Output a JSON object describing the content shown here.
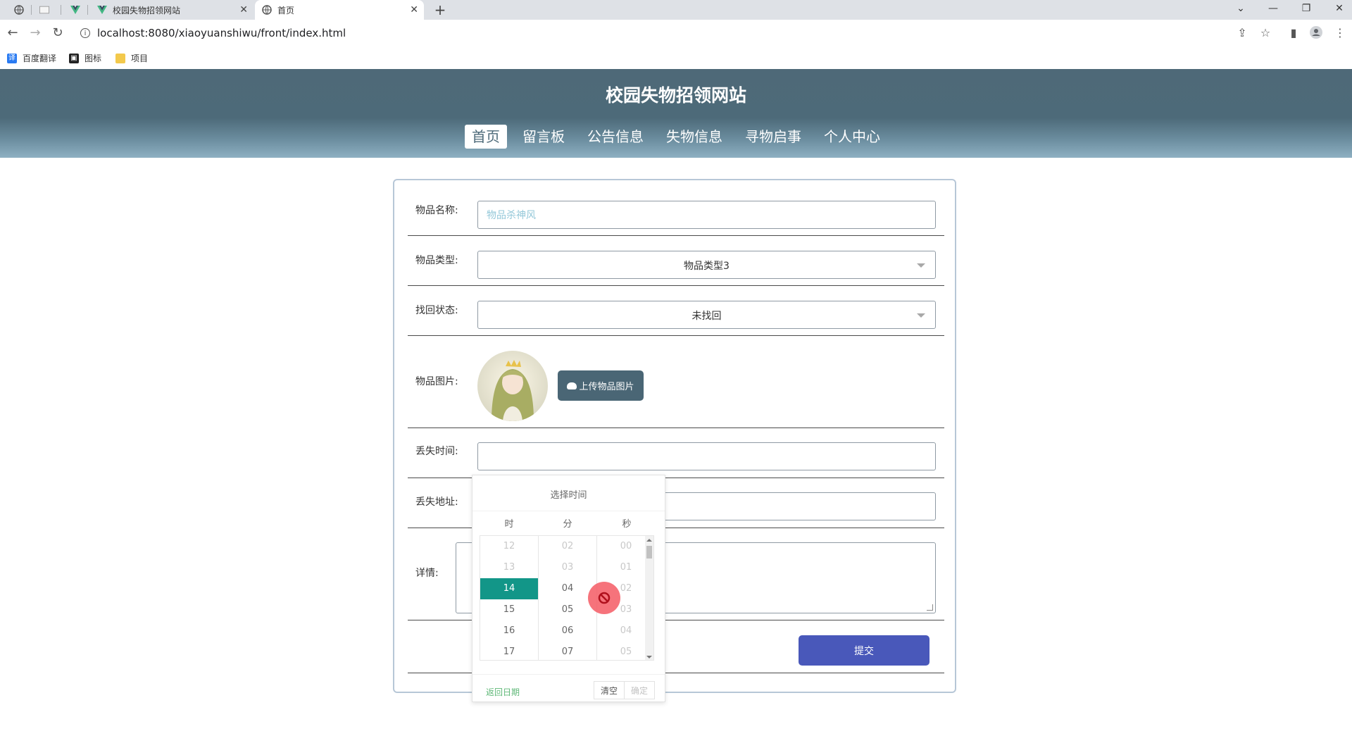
{
  "browser": {
    "tabs": [
      {
        "title": "校园失物招领网站"
      },
      {
        "title": "首页"
      }
    ],
    "url": "localhost:8080/xiaoyuanshiwu/front/index.html",
    "bookmarks": [
      {
        "label": "百度翻译"
      },
      {
        "label": "图标"
      },
      {
        "label": "项目"
      }
    ]
  },
  "site": {
    "title": "校园失物招领网站",
    "nav": [
      {
        "label": "首页"
      },
      {
        "label": "留言板"
      },
      {
        "label": "公告信息"
      },
      {
        "label": "失物信息"
      },
      {
        "label": "寻物启事"
      },
      {
        "label": "个人中心"
      }
    ],
    "active_nav": "首页"
  },
  "form": {
    "name_label": "物品名称:",
    "name_placeholder": "物品杀神风",
    "type_label": "物品类型:",
    "type_value": "物品类型3",
    "status_label": "找回状态:",
    "status_value": "未找回",
    "image_label": "物品图片:",
    "upload_label": "上传物品图片",
    "lost_time_label": "丢失时间:",
    "lost_address_label": "丢失地址:",
    "detail_label": "详情:",
    "submit_label": "提交"
  },
  "time_picker": {
    "title": "选择时间",
    "headers": {
      "hour": "时",
      "minute": "分",
      "second": "秒"
    },
    "hours": [
      "12",
      "13",
      "14",
      "15",
      "16",
      "17"
    ],
    "minutes": [
      "02",
      "03",
      "04",
      "05",
      "06",
      "07"
    ],
    "seconds": [
      "00",
      "01",
      "02",
      "03",
      "04",
      "05"
    ],
    "selected_hour": "14",
    "back_label": "返回日期",
    "clear_label": "清空",
    "confirm_label": "确定"
  },
  "colors": {
    "header": "#4d6a79",
    "selected": "#129688",
    "submit": "#4958ba",
    "upload": "#4a6675"
  }
}
